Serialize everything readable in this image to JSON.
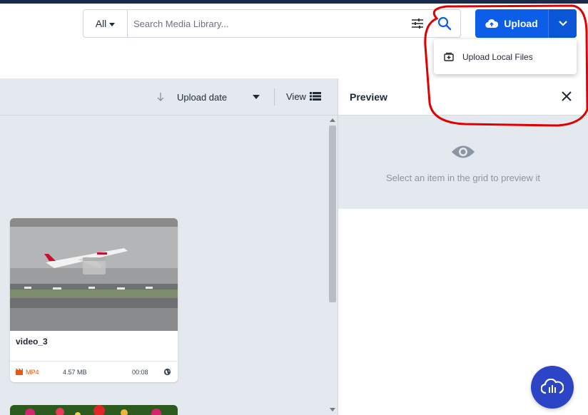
{
  "search": {
    "scope": "All",
    "placeholder": "Search Media Library...",
    "value": ""
  },
  "upload": {
    "label": "Upload",
    "menu_items": [
      {
        "label": "Upload Local Files",
        "icon": "upload-file-icon"
      }
    ]
  },
  "toolbar": {
    "sort_label": "Upload date",
    "view_label": "View"
  },
  "grid": {
    "items": [
      {
        "title": "video_3",
        "format": "MP4",
        "size": "4.57 MB",
        "duration": "00:08"
      }
    ]
  },
  "preview": {
    "title": "Preview",
    "empty_message": "Select an item in the grid to preview it"
  },
  "colors": {
    "primary": "#0c5ee8",
    "annotation": "#e00000",
    "format_accent": "#e8590c",
    "fab": "#2c44c6"
  }
}
